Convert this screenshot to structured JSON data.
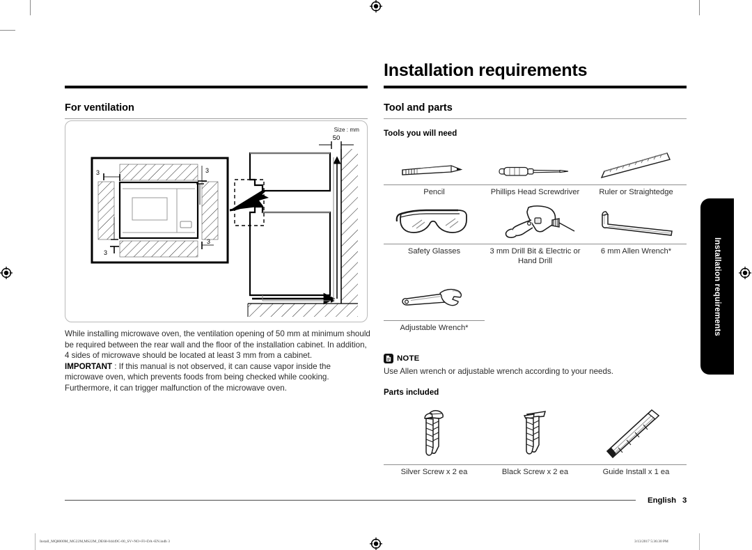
{
  "chapter": {
    "title": "Installation requirements"
  },
  "side_tab": {
    "label": "Installation requirements"
  },
  "left_column": {
    "section_title": "For ventilation",
    "figure": {
      "size_label": "Size : mm",
      "gap_value": "50",
      "clearance_top_left": "3",
      "clearance_top_right": "3",
      "clearance_bottom_left": "3",
      "clearance_bottom_right": "3"
    },
    "paragraph_1": "While installing microwave oven, the ventilation opening of 50 mm at minimum should be required between the rear wall and the floor of the installation cabinet. In addition, 4 sides of microwave should be located at least 3 mm from a cabinet.",
    "important_label": "IMPORTANT",
    "important_separator": " : ",
    "important_text": "If this manual is not observed, it can cause vapor inside the microwave oven, which prevents foods from being checked while cooking. Furthermore, it can trigger malfunction of the microwave oven."
  },
  "right_column": {
    "section_title": "Tool and parts",
    "tools_heading": "Tools you will need",
    "tools": [
      {
        "label": "Pencil",
        "icon": "pencil-icon"
      },
      {
        "label": "Phillips Head Screwdriver",
        "icon": "screwdriver-icon"
      },
      {
        "label": "Ruler or Straightedge",
        "icon": "ruler-icon"
      },
      {
        "label": "Safety Glasses",
        "icon": "safety-glasses-icon"
      },
      {
        "label": "3 mm Drill Bit & Electric or Hand Drill",
        "icon": "drill-icon"
      },
      {
        "label": "6 mm Allen Wrench*",
        "icon": "allen-wrench-icon"
      },
      {
        "label": "Adjustable Wrench*",
        "icon": "adjustable-wrench-icon"
      }
    ],
    "note": {
      "icon": "note-document-icon",
      "title": "NOTE",
      "text": "Use Allen wrench or adjustable wrench according to your needs."
    },
    "parts_heading": "Parts included",
    "parts": [
      {
        "label": "Silver Screw x 2 ea",
        "icon": "silver-screw-icon"
      },
      {
        "label": "Black Screw x 2 ea",
        "icon": "black-screw-icon"
      },
      {
        "label": "Guide Install x 1 ea",
        "icon": "guide-install-icon"
      }
    ]
  },
  "footer": {
    "language": "English",
    "page_number": "3",
    "print_file": "Install_MQ8000M_MG22M,MS22M_DE68-04449C-00_SV+NO+FI+DA+EN.indb   3",
    "print_timestamp": "3/13/2017   5:36:30 PM"
  }
}
